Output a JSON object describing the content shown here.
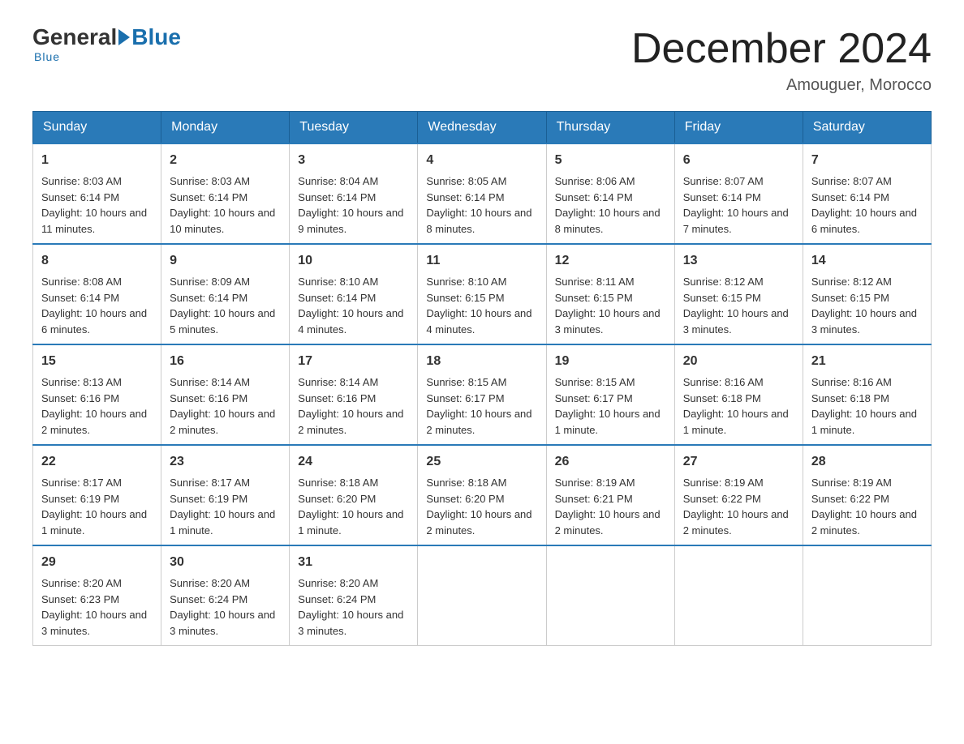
{
  "logo": {
    "general": "General",
    "blue": "Blue",
    "subtitle": "Blue"
  },
  "header": {
    "title": "December 2024",
    "location": "Amouguer, Morocco"
  },
  "weekdays": [
    "Sunday",
    "Monday",
    "Tuesday",
    "Wednesday",
    "Thursday",
    "Friday",
    "Saturday"
  ],
  "weeks": [
    [
      {
        "day": "1",
        "sunrise": "8:03 AM",
        "sunset": "6:14 PM",
        "daylight": "10 hours and 11 minutes."
      },
      {
        "day": "2",
        "sunrise": "8:03 AM",
        "sunset": "6:14 PM",
        "daylight": "10 hours and 10 minutes."
      },
      {
        "day": "3",
        "sunrise": "8:04 AM",
        "sunset": "6:14 PM",
        "daylight": "10 hours and 9 minutes."
      },
      {
        "day": "4",
        "sunrise": "8:05 AM",
        "sunset": "6:14 PM",
        "daylight": "10 hours and 8 minutes."
      },
      {
        "day": "5",
        "sunrise": "8:06 AM",
        "sunset": "6:14 PM",
        "daylight": "10 hours and 8 minutes."
      },
      {
        "day": "6",
        "sunrise": "8:07 AM",
        "sunset": "6:14 PM",
        "daylight": "10 hours and 7 minutes."
      },
      {
        "day": "7",
        "sunrise": "8:07 AM",
        "sunset": "6:14 PM",
        "daylight": "10 hours and 6 minutes."
      }
    ],
    [
      {
        "day": "8",
        "sunrise": "8:08 AM",
        "sunset": "6:14 PM",
        "daylight": "10 hours and 6 minutes."
      },
      {
        "day": "9",
        "sunrise": "8:09 AM",
        "sunset": "6:14 PM",
        "daylight": "10 hours and 5 minutes."
      },
      {
        "day": "10",
        "sunrise": "8:10 AM",
        "sunset": "6:14 PM",
        "daylight": "10 hours and 4 minutes."
      },
      {
        "day": "11",
        "sunrise": "8:10 AM",
        "sunset": "6:15 PM",
        "daylight": "10 hours and 4 minutes."
      },
      {
        "day": "12",
        "sunrise": "8:11 AM",
        "sunset": "6:15 PM",
        "daylight": "10 hours and 3 minutes."
      },
      {
        "day": "13",
        "sunrise": "8:12 AM",
        "sunset": "6:15 PM",
        "daylight": "10 hours and 3 minutes."
      },
      {
        "day": "14",
        "sunrise": "8:12 AM",
        "sunset": "6:15 PM",
        "daylight": "10 hours and 3 minutes."
      }
    ],
    [
      {
        "day": "15",
        "sunrise": "8:13 AM",
        "sunset": "6:16 PM",
        "daylight": "10 hours and 2 minutes."
      },
      {
        "day": "16",
        "sunrise": "8:14 AM",
        "sunset": "6:16 PM",
        "daylight": "10 hours and 2 minutes."
      },
      {
        "day": "17",
        "sunrise": "8:14 AM",
        "sunset": "6:16 PM",
        "daylight": "10 hours and 2 minutes."
      },
      {
        "day": "18",
        "sunrise": "8:15 AM",
        "sunset": "6:17 PM",
        "daylight": "10 hours and 2 minutes."
      },
      {
        "day": "19",
        "sunrise": "8:15 AM",
        "sunset": "6:17 PM",
        "daylight": "10 hours and 1 minute."
      },
      {
        "day": "20",
        "sunrise": "8:16 AM",
        "sunset": "6:18 PM",
        "daylight": "10 hours and 1 minute."
      },
      {
        "day": "21",
        "sunrise": "8:16 AM",
        "sunset": "6:18 PM",
        "daylight": "10 hours and 1 minute."
      }
    ],
    [
      {
        "day": "22",
        "sunrise": "8:17 AM",
        "sunset": "6:19 PM",
        "daylight": "10 hours and 1 minute."
      },
      {
        "day": "23",
        "sunrise": "8:17 AM",
        "sunset": "6:19 PM",
        "daylight": "10 hours and 1 minute."
      },
      {
        "day": "24",
        "sunrise": "8:18 AM",
        "sunset": "6:20 PM",
        "daylight": "10 hours and 1 minute."
      },
      {
        "day": "25",
        "sunrise": "8:18 AM",
        "sunset": "6:20 PM",
        "daylight": "10 hours and 2 minutes."
      },
      {
        "day": "26",
        "sunrise": "8:19 AM",
        "sunset": "6:21 PM",
        "daylight": "10 hours and 2 minutes."
      },
      {
        "day": "27",
        "sunrise": "8:19 AM",
        "sunset": "6:22 PM",
        "daylight": "10 hours and 2 minutes."
      },
      {
        "day": "28",
        "sunrise": "8:19 AM",
        "sunset": "6:22 PM",
        "daylight": "10 hours and 2 minutes."
      }
    ],
    [
      {
        "day": "29",
        "sunrise": "8:20 AM",
        "sunset": "6:23 PM",
        "daylight": "10 hours and 3 minutes."
      },
      {
        "day": "30",
        "sunrise": "8:20 AM",
        "sunset": "6:24 PM",
        "daylight": "10 hours and 3 minutes."
      },
      {
        "day": "31",
        "sunrise": "8:20 AM",
        "sunset": "6:24 PM",
        "daylight": "10 hours and 3 minutes."
      },
      null,
      null,
      null,
      null
    ]
  ],
  "labels": {
    "sunrise": "Sunrise:",
    "sunset": "Sunset:",
    "daylight": "Daylight:"
  }
}
